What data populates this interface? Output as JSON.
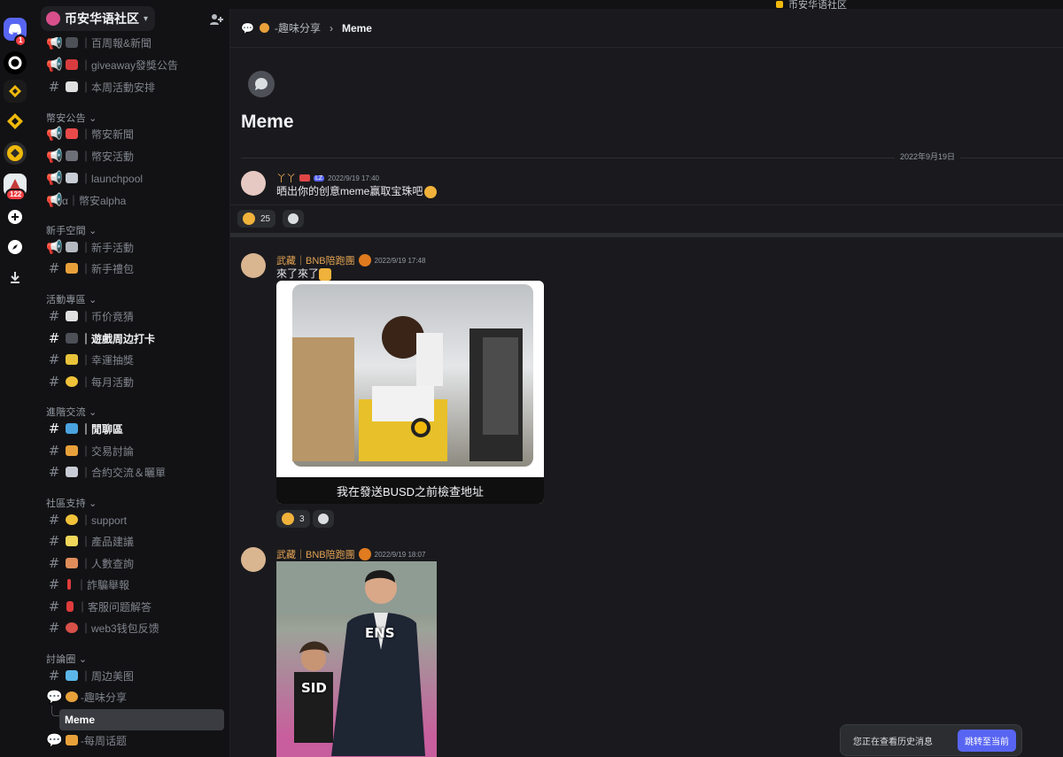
{
  "titlebar": {
    "title": "币安华语社区"
  },
  "rail": {
    "discord_badge": "1",
    "server_badge": "122"
  },
  "server": {
    "name": "币安华语社区"
  },
  "channels": {
    "top": [
      {
        "label": "｜百周報&新聞"
      },
      {
        "label": "｜giveaway發獎公告"
      },
      {
        "label": "｜本周活動安排"
      }
    ],
    "cat1": "幣安公告",
    "cat1_items": [
      {
        "label": "｜幣安新聞"
      },
      {
        "label": "｜幣安活動"
      },
      {
        "label": "｜launchpool"
      },
      {
        "label": "α｜幣安alpha"
      }
    ],
    "cat2": "新手空間",
    "cat2_items": [
      {
        "label": "｜新手活動"
      },
      {
        "label": "｜新手禮包"
      }
    ],
    "cat3": "活動專區",
    "cat3_items": [
      {
        "label": "｜币价竟猜"
      },
      {
        "label": "｜遊戲周边打卡"
      },
      {
        "label": "｜幸運抽獎"
      },
      {
        "label": "｜每月活動"
      }
    ],
    "cat4": "進階交流",
    "cat4_items": [
      {
        "label": "｜閒聊區"
      },
      {
        "label": "｜交易討論"
      },
      {
        "label": "｜合約交流＆曬單"
      }
    ],
    "cat5": "社區支持",
    "cat5_items": [
      {
        "label": "｜support"
      },
      {
        "label": "｜產品建議"
      },
      {
        "label": "｜人數查詢"
      },
      {
        "label": "｜詐騙舉報"
      },
      {
        "label": "｜客服问题解答"
      },
      {
        "label": "｜web3钱包反馈"
      }
    ],
    "cat6": "討論圈",
    "cat6_items": [
      {
        "label": "｜周边美图"
      },
      {
        "label": "-趣味分享"
      },
      {
        "label": "Meme"
      },
      {
        "label": "-每周话题"
      }
    ]
  },
  "header": {
    "parent": "-趣味分享",
    "current": "Meme"
  },
  "post": {
    "title": "Meme",
    "date_divider": "2022年9月19日"
  },
  "messages": [
    {
      "user": "丫丫",
      "tag": "LZ",
      "time": "2022/9/19 17:40",
      "text": "晒出你的创意meme赢取宝珠吧",
      "reaction_count": "25"
    },
    {
      "user": "武藏｜BNB陪跑團",
      "time": "2022/9/19 17:48",
      "text": "來了來了",
      "caption": "我在發送BUSD之前檢查地址",
      "reaction_count": "3"
    },
    {
      "user": "武藏｜BNB陪跑團",
      "time": "2022/9/19 18:07",
      "labels": [
        "ENS",
        "SID"
      ]
    }
  ],
  "toast": {
    "text": "您正在查看历史消息",
    "button": "跳转至当前"
  },
  "colors": {
    "accent": "#5865f2",
    "username": "#e4a454",
    "badge": "#f23f43",
    "binance": "#f0b90b"
  }
}
